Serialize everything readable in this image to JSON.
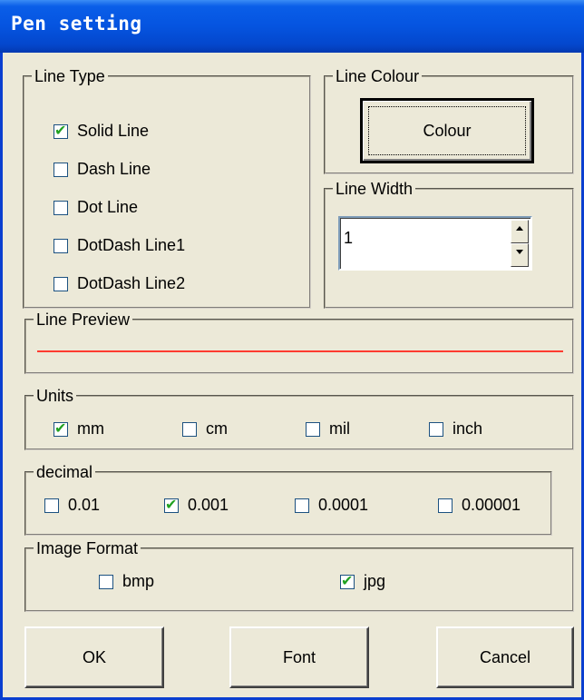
{
  "window": {
    "title": "Pen setting"
  },
  "line_type": {
    "legend": "Line Type",
    "options": [
      {
        "label": "Solid Line",
        "checked": true
      },
      {
        "label": "Dash Line",
        "checked": false
      },
      {
        "label": "Dot Line",
        "checked": false
      },
      {
        "label": "DotDash Line1",
        "checked": false
      },
      {
        "label": "DotDash Line2",
        "checked": false
      }
    ]
  },
  "line_colour": {
    "legend": "Line Colour",
    "button_label": "Colour"
  },
  "line_width": {
    "legend": "Line Width",
    "value": "1"
  },
  "line_preview": {
    "legend": "Line Preview",
    "line_color": "#ff3b30"
  },
  "units": {
    "legend": "Units",
    "options": [
      {
        "label": "mm",
        "checked": true
      },
      {
        "label": "cm",
        "checked": false
      },
      {
        "label": "mil",
        "checked": false
      },
      {
        "label": "inch",
        "checked": false
      }
    ]
  },
  "decimal": {
    "legend": "decimal",
    "options": [
      {
        "label": "0.01",
        "checked": false
      },
      {
        "label": "0.001",
        "checked": true
      },
      {
        "label": "0.0001",
        "checked": false
      },
      {
        "label": "0.00001",
        "checked": false
      }
    ]
  },
  "image_format": {
    "legend": "Image Format",
    "options": [
      {
        "label": "bmp",
        "checked": false
      },
      {
        "label": "jpg",
        "checked": true
      }
    ]
  },
  "buttons": {
    "ok": "OK",
    "font": "Font",
    "cancel": "Cancel"
  }
}
